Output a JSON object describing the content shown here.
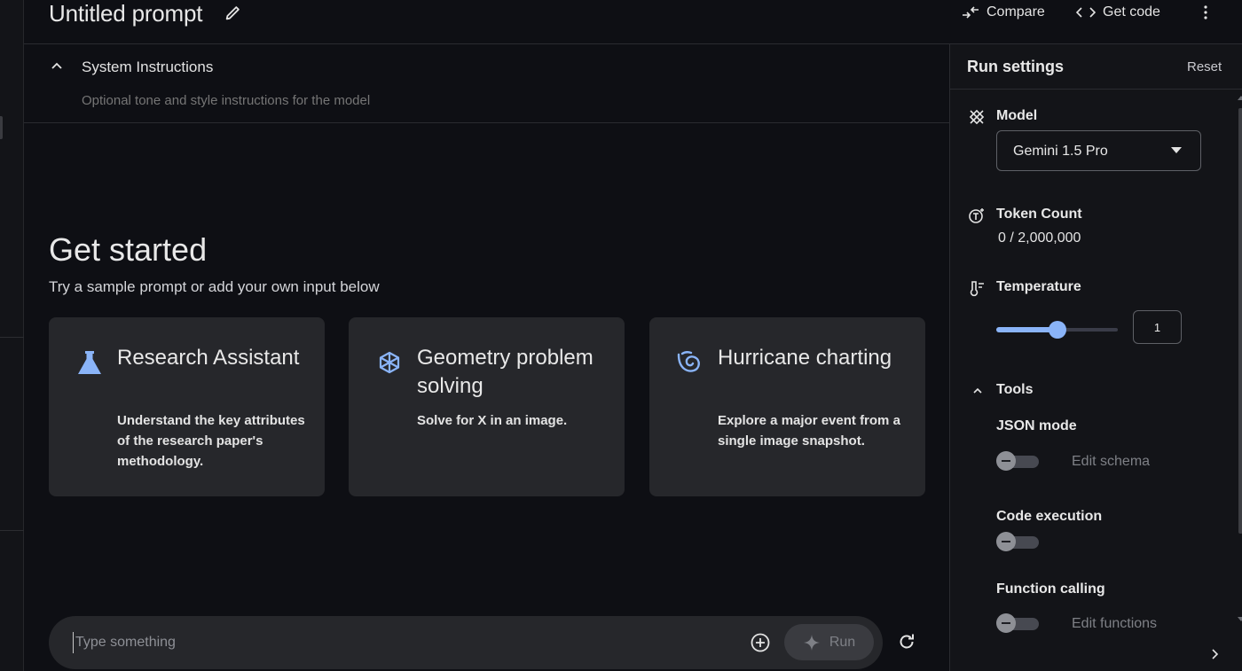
{
  "header": {
    "title": "Untitled prompt",
    "compare_label": "Compare",
    "get_code_label": "Get code"
  },
  "system_instructions": {
    "title": "System Instructions",
    "placeholder": "Optional tone and style instructions for the model"
  },
  "get_started": {
    "title": "Get started",
    "subtitle": "Try a sample prompt or add your own input below"
  },
  "cards": [
    {
      "icon": "flask-icon",
      "title": "Research Assistant",
      "description": "Understand the key attributes of the research paper's methodology."
    },
    {
      "icon": "cube-icon",
      "title": "Geometry problem solving",
      "description": "Solve for X in an image."
    },
    {
      "icon": "hurricane-icon",
      "title": "Hurricane charting",
      "description": "Explore a major event from a single image snapshot."
    }
  ],
  "prompt": {
    "placeholder": "Type something",
    "run_label": "Run"
  },
  "run_settings": {
    "title": "Run settings",
    "reset_label": "Reset",
    "model_label": "Model",
    "model_value": "Gemini 1.5 Pro",
    "token_count_label": "Token Count",
    "token_count_value": "0 / 2,000,000",
    "temperature_label": "Temperature",
    "temperature_value": "1",
    "temperature_fraction": 0.5,
    "tools_label": "Tools",
    "json_mode_label": "JSON mode",
    "edit_schema_label": "Edit schema",
    "code_execution_label": "Code execution",
    "function_calling_label": "Function calling",
    "edit_functions_label": "Edit functions"
  },
  "colors": {
    "accent": "#8ab4f8",
    "background": "#0e0f14",
    "card": "#26272b"
  }
}
